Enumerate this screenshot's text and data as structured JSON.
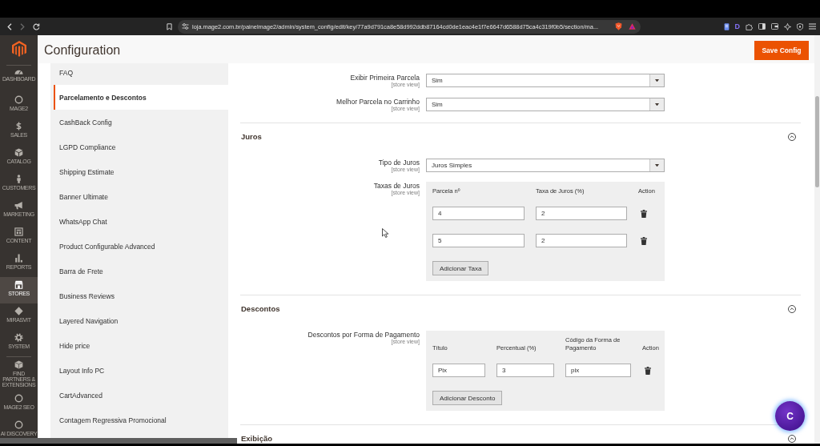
{
  "browser": {
    "url": "loja.mage2.com.br/painelmage2/admin/system_config/edit/key/77a9d791ca8e58d992ddb87164cd0de1eac4e1f7e6647d6588d75ca4c319f0b5/section/ma...",
    "extension_label": "D"
  },
  "admin_menu": {
    "groups": [
      {
        "items": [
          {
            "label": "DASHBOARD",
            "selected": false
          },
          {
            "label": "MAGE2",
            "selected": false
          },
          {
            "label": "SALES",
            "selected": false
          },
          {
            "label": "CATALOG",
            "selected": false
          },
          {
            "label": "CUSTOMERS",
            "selected": false
          },
          {
            "label": "MARKETING",
            "selected": false
          },
          {
            "label": "CONTENT",
            "selected": false
          },
          {
            "label": "REPORTS",
            "selected": false
          },
          {
            "label": "STORES",
            "selected": true
          },
          {
            "label": "MIRASVIT",
            "selected": false
          },
          {
            "label": "SYSTEM",
            "selected": false
          }
        ]
      },
      {
        "items": [
          {
            "label": "FIND PARTNERS & EXTENSIONS",
            "selected": false
          },
          {
            "label": "MAGE2 SEO",
            "selected": false
          },
          {
            "label": "AI DISCOVERY",
            "selected": false
          }
        ]
      }
    ]
  },
  "page_header": {
    "title": "Configuration",
    "save_button": "Save Config"
  },
  "config_nav": {
    "items": [
      {
        "label": "FAQ",
        "selected": false
      },
      {
        "label": "Parcelamento e Descontos",
        "selected": true
      },
      {
        "label": "CashBack Config",
        "selected": false
      },
      {
        "label": "LGPD Compliance",
        "selected": false
      },
      {
        "label": "Shipping Estimate",
        "selected": false
      },
      {
        "label": "Banner Ultimate",
        "selected": false
      },
      {
        "label": "WhatsApp Chat",
        "selected": false
      },
      {
        "label": "Product Configurable Advanced",
        "selected": false
      },
      {
        "label": "Barra de Frete",
        "selected": false
      },
      {
        "label": "Business Reviews",
        "selected": false
      },
      {
        "label": "Layered Navigation",
        "selected": false
      },
      {
        "label": "Hide price",
        "selected": false
      },
      {
        "label": "Layout Info PC",
        "selected": false
      },
      {
        "label": "CartAdvanced",
        "selected": false
      },
      {
        "label": "Contagem Regressiva Promocional",
        "selected": false
      }
    ]
  },
  "form": {
    "fields": [
      {
        "kind": "select",
        "label": "Exibir Primeira Parcela",
        "scope": "[store view]",
        "value": "Sim"
      },
      {
        "kind": "select",
        "label": "Melhor Parcela no Carrinho",
        "scope": "[store view]",
        "value": "Sim"
      }
    ],
    "sections": [
      {
        "title": "Juros",
        "expanded": true,
        "fields": [
          {
            "kind": "select",
            "label": "Tipo de Juros",
            "scope": "[store view]",
            "value": "Juros Simples"
          },
          {
            "kind": "table",
            "label": "Taxas de Juros",
            "scope": "[store view]",
            "columns": [
              "Parcela nº",
              "Taxa de Juros (%)",
              "Action"
            ],
            "rows": [
              {
                "cells": [
                  "4",
                  "2"
                ]
              },
              {
                "cells": [
                  "5",
                  "2"
                ]
              }
            ],
            "add_button": "Adicionar Taxa"
          }
        ]
      },
      {
        "title": "Descontos",
        "expanded": true,
        "fields": [
          {
            "kind": "table",
            "label": "Descontos por Forma de Pagamento",
            "scope": "[store view]",
            "columns": [
              "Título",
              "Percentual (%)",
              "Código da Forma de Pagamento",
              "Action"
            ],
            "rows": [
              {
                "cells": [
                  "Pix",
                  "3",
                  "pix"
                ]
              }
            ],
            "add_button": "Adicionar Desconto"
          }
        ]
      },
      {
        "title": "Exibição",
        "expanded": true
      }
    ]
  },
  "chat_widget": {
    "label": "C"
  }
}
